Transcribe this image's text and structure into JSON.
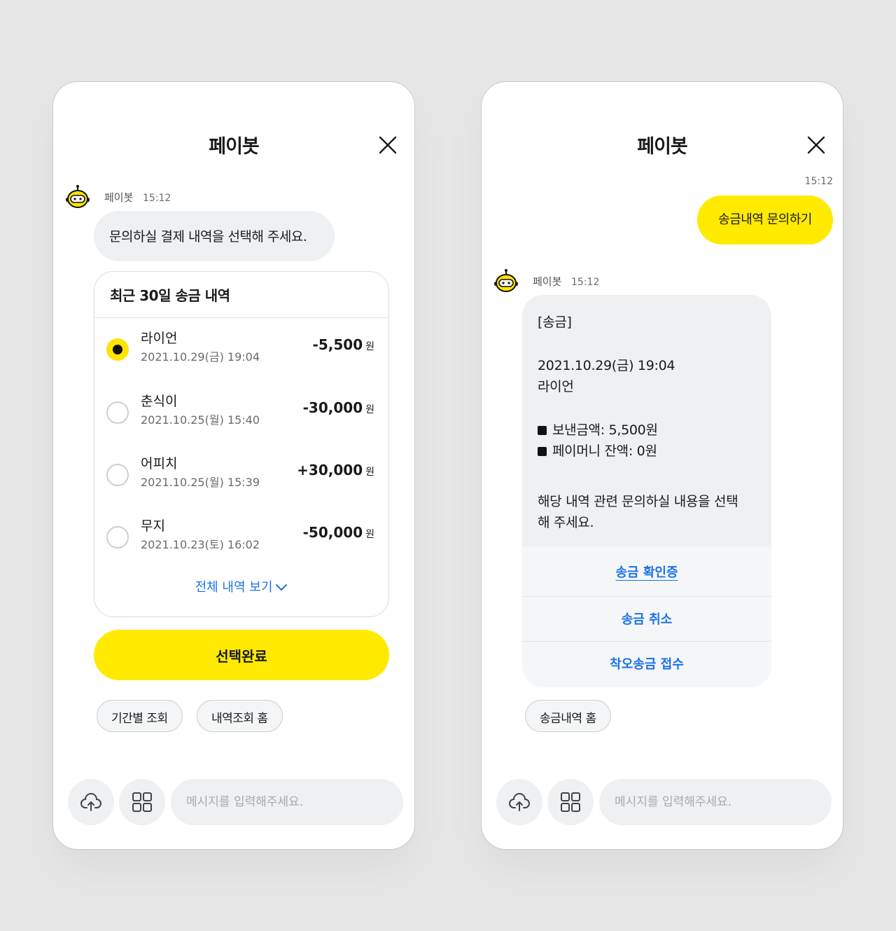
{
  "left": {
    "title": "페이봇",
    "bot_name": "페이봇",
    "bot_time": "15:12",
    "bot_message": "문의하실 결제 내역을 선택해 주세요.",
    "card_title": "최근 30일 송금 내역",
    "transactions": [
      {
        "name": "라이언",
        "date": "2021.10.29(금) 19:04",
        "amount": "-5,500",
        "unit": "원",
        "selected": true
      },
      {
        "name": "춘식이",
        "date": "2021.10.25(월) 15:40",
        "amount": "-30,000",
        "unit": "원",
        "selected": false
      },
      {
        "name": "어피치",
        "date": "2021.10.25(월) 15:39",
        "amount": "+30,000",
        "unit": "원",
        "selected": false
      },
      {
        "name": "무지",
        "date": "2021.10.23(토) 16:02",
        "amount": "-50,000",
        "unit": "원",
        "selected": false
      }
    ],
    "view_all": "전체 내역 보기",
    "confirm_button": "선택완료",
    "chips": [
      "기간별 조회",
      "내역조회 홈"
    ],
    "input_placeholder": "메시지를 입력해주세요."
  },
  "right": {
    "title": "페이봇",
    "user_time": "15:12",
    "user_message": "송금내역 문의하기",
    "bot_name": "페이봇",
    "bot_time": "15:12",
    "info": {
      "tag": "[송금]",
      "datetime": "2021.10.29(금) 19:04",
      "recipient": "라이언",
      "sent_amount": "보낸금액: 5,500원",
      "balance": "페이머니 잔액: 0원",
      "prompt_line1": "해당 내역 관련 문의하실 내용을 선택",
      "prompt_line2": "해 주세요."
    },
    "actions": [
      "송금 확인증",
      "송금 취소",
      "착오송금 접수"
    ],
    "chip": "송금내역 홈",
    "input_placeholder": "메시지를 입력해주세요."
  },
  "colors": {
    "accent": "#ffea00",
    "link": "#1a73e8",
    "bubble": "#eef0f2"
  },
  "icons": [
    "close-icon",
    "paybot-avatar-icon",
    "upload-icon",
    "grid-menu-icon",
    "chevron-down-icon"
  ]
}
